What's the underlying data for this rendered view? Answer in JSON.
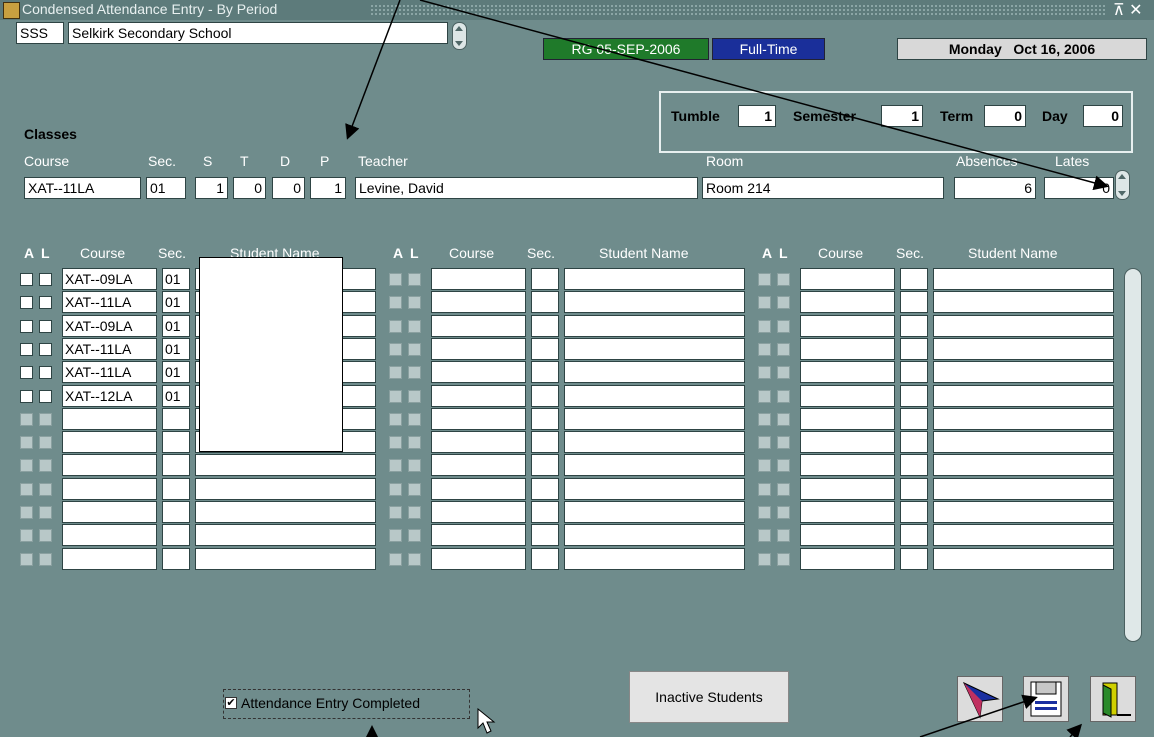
{
  "window": {
    "title": "Condensed Attendance Entry - By Period",
    "controls": "⊼ ✕"
  },
  "header": {
    "school_code": "SSS",
    "school_name": "Selkirk Secondary School",
    "rg_badge": "RG 05-SEP-2006",
    "fulltime_badge": "Full-Time",
    "date_day": "Monday",
    "date": "Oct 16, 2006"
  },
  "schedule": {
    "tumble_label": "Tumble",
    "tumble": "1",
    "semester_label": "Semester",
    "semester": "1",
    "term_label": "Term",
    "term": "0",
    "day_label": "Day",
    "day": "0"
  },
  "classes": {
    "heading": "Classes",
    "labels": {
      "course": "Course",
      "sec": "Sec.",
      "s": "S",
      "t": "T",
      "d": "D",
      "p": "P",
      "teacher": "Teacher",
      "room": "Room",
      "absences": "Absences",
      "lates": "Lates"
    },
    "course": "XAT--11LA",
    "sec": "01",
    "s": "1",
    "t": "0",
    "d": "0",
    "p": "1",
    "teacher": "Levine, David",
    "room": "Room 214",
    "absences": "6",
    "lates": "0"
  },
  "grid": {
    "headers": {
      "a": "A",
      "l": "L",
      "course": "Course",
      "sec": "Sec.",
      "student": "Student Name"
    },
    "rows": [
      {
        "course": "XAT--09LA",
        "sec": "01"
      },
      {
        "course": "XAT--11LA",
        "sec": "01"
      },
      {
        "course": "XAT--09LA",
        "sec": "01"
      },
      {
        "course": "XAT--11LA",
        "sec": "01"
      },
      {
        "course": "XAT--11LA",
        "sec": "01"
      },
      {
        "course": "XAT--12LA",
        "sec": "01"
      }
    ]
  },
  "footer": {
    "attendance_completed_label": "Attendance Entry Completed",
    "attendance_completed_checked": true,
    "inactive_button": "Inactive Students"
  },
  "colors": {
    "background": "#6f8c8c",
    "rg_badge": "#1f7a2a",
    "fulltime_badge": "#1a2f9a"
  },
  "icons": [
    "app-icon",
    "navigate-icon",
    "save-icon",
    "exit-door-icon",
    "mouse-cursor-icon"
  ]
}
